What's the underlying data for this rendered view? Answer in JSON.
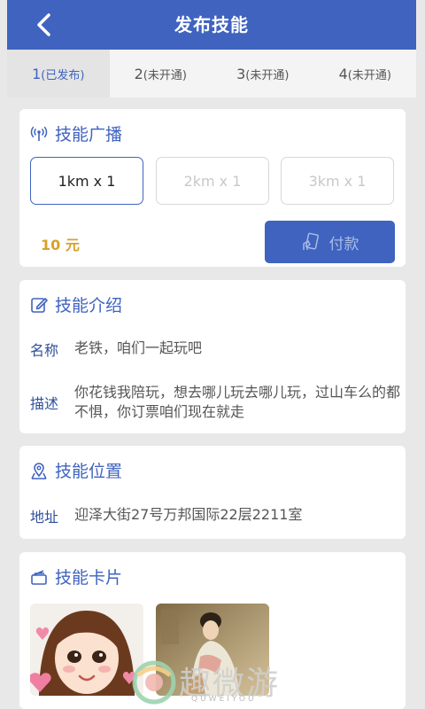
{
  "header": {
    "title": "发布技能"
  },
  "tabs": [
    {
      "num": "1",
      "status": "(已发布)"
    },
    {
      "num": "2",
      "status": "(未开通)"
    },
    {
      "num": "3",
      "status": "(未开通)"
    },
    {
      "num": "4",
      "status": "(未开通)"
    }
  ],
  "broadcast": {
    "title": "技能广播",
    "options": [
      "1km  x  1",
      "2km  x  1",
      "3km  x  1"
    ],
    "price": "10 元",
    "pay_label": "付款"
  },
  "intro": {
    "title": "技能介绍",
    "name_label": "名称",
    "name_value": "老铁，咱们一起玩吧",
    "desc_label": "描述",
    "desc_value": "你花钱我陪玩，想去哪儿玩去哪儿玩，过山车么的都不惧，你订票咱们现在就走"
  },
  "location": {
    "title": "技能位置",
    "address_label": "地址",
    "address_value": "迎泽大街27号万邦国际22层2211室"
  },
  "cards": {
    "title": "技能卡片"
  },
  "watermark": {
    "text": "趣微游",
    "sub": "QUWEIYOU"
  },
  "colors": {
    "brand": "#3f63bf",
    "price": "#d9a128",
    "background": "#e8e8e8"
  }
}
